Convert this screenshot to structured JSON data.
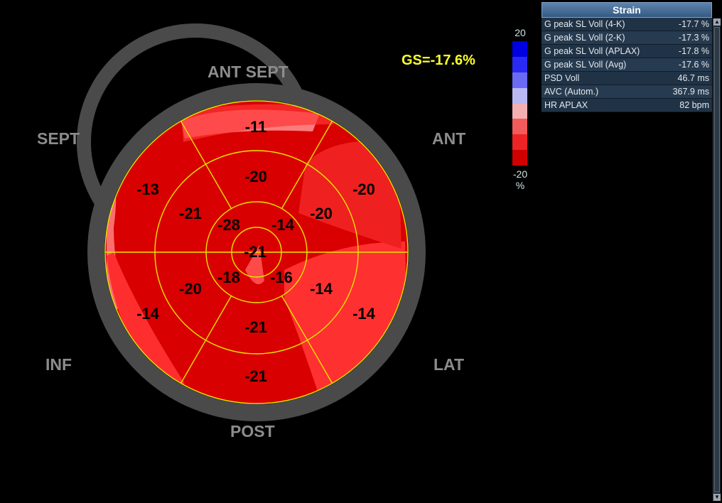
{
  "orientation": {
    "ant_sept": "ANT  SEPT",
    "sept": "SEPT",
    "ant": "ANT",
    "inf": "INF",
    "lat": "LAT",
    "post": "POST"
  },
  "global_strain": "GS=-17.6%",
  "color_scale": {
    "max_label": "20",
    "min_label": "-20",
    "unit": "%",
    "colors": [
      "#0000e0",
      "#2a2af5",
      "#6a6af5",
      "#b8b8f3",
      "#f3b0b0",
      "#f35a5a",
      "#ee2424",
      "#d00000"
    ]
  },
  "segments": {
    "basal": [
      "-11",
      "-20",
      "-14",
      "-21",
      "-14",
      "-13"
    ],
    "mid": [
      "-20",
      "-20",
      "-14",
      "-21",
      "-20",
      "-21"
    ],
    "apical": [
      "-14",
      "-16",
      "-18",
      "-28"
    ],
    "apex": "-21"
  },
  "strain_panel": {
    "title": "Strain",
    "rows": [
      {
        "label": "G peak SL Voll (4-K)",
        "value": "-17.7 %"
      },
      {
        "label": "G peak SL Voll (2-K)",
        "value": "-17.3 %"
      },
      {
        "label": "G peak SL Voll (APLAX)",
        "value": "-17.8 %"
      },
      {
        "label": "G peak SL Voll (Avg)",
        "value": "-17.6 %"
      },
      {
        "label": "PSD Voll",
        "value": "46.7 ms"
      },
      {
        "label": "AVC (Autom.)",
        "value": "367.9 ms"
      },
      {
        "label": "HR APLAX",
        "value": "82 bpm"
      }
    ]
  },
  "scrollbar": {
    "up_icon": "arrow-up-icon",
    "down_icon": "arrow-down-icon"
  }
}
